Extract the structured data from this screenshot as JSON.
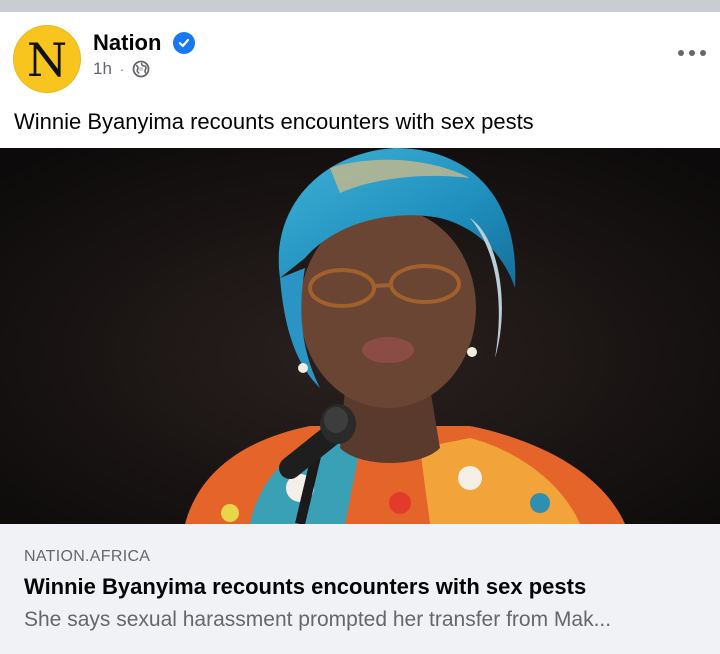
{
  "post": {
    "page_name": "Nation",
    "avatar_letter": "N",
    "time": "1h",
    "separator": "·",
    "text": "Winnie Byanyima recounts encounters with sex pests",
    "icons": {
      "verified": "verified-badge-icon",
      "audience": "globe-icon",
      "more": "more-options-icon"
    }
  },
  "link_card": {
    "domain": "NATION.AFRICA",
    "headline": "Winnie Byanyima recounts encounters with sex pests",
    "description": "She says sexual harassment prompted her transfer from Mak..."
  },
  "colors": {
    "avatar_bg": "#f7c51e",
    "verified": "#1877f2",
    "secondary_text": "#65676b",
    "card_footer_bg": "#f0f2f5",
    "photo_bg": "#141010"
  }
}
